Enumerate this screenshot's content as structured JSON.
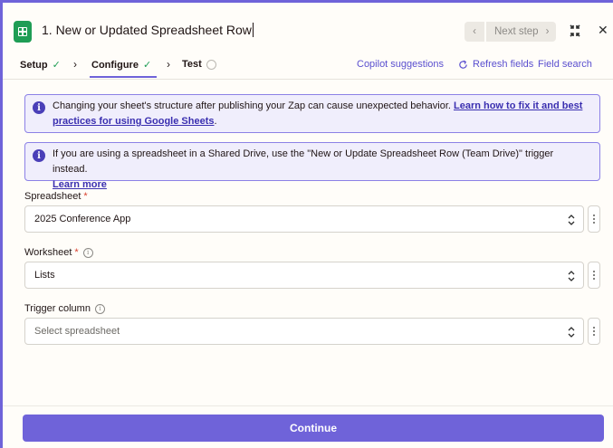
{
  "header": {
    "title": "1. New or Updated Spreadsheet Row",
    "next_step_label": "Next step",
    "prev_icon": "chevron-left-icon",
    "next_icon": "chevron-right-icon",
    "collapse_icon": "collapse-icon",
    "close_icon": "close-icon"
  },
  "tabs": {
    "setup": "Setup",
    "configure": "Configure",
    "test": "Test",
    "copilot": "Copilot suggestions",
    "refresh": "Refresh fields",
    "field_search": "Field search"
  },
  "notices": {
    "first_text": "Changing your sheet's structure after publishing your Zap can cause unexpected behavior. ",
    "first_link": "Learn how to fix it and best practices for using Google Sheets",
    "first_end": ".",
    "second_text": "If you are using a spreadsheet in a Shared Drive, use the \"New or Update Spreadsheet Row (Team Drive)\" trigger instead.",
    "second_link": "Learn more"
  },
  "fields": {
    "spreadsheet_label": "Spreadsheet",
    "spreadsheet_value": "2025 Conference App",
    "worksheet_label": "Worksheet",
    "worksheet_value": "Lists",
    "trigger_label": "Trigger column",
    "trigger_placeholder": "Select spreadsheet",
    "required_mark": "*"
  },
  "footer": {
    "continue_label": "Continue"
  },
  "colors": {
    "accent": "#6f63d9",
    "success": "#1f9d55",
    "required": "#d9412e",
    "info_bg": "#f0eefc"
  }
}
